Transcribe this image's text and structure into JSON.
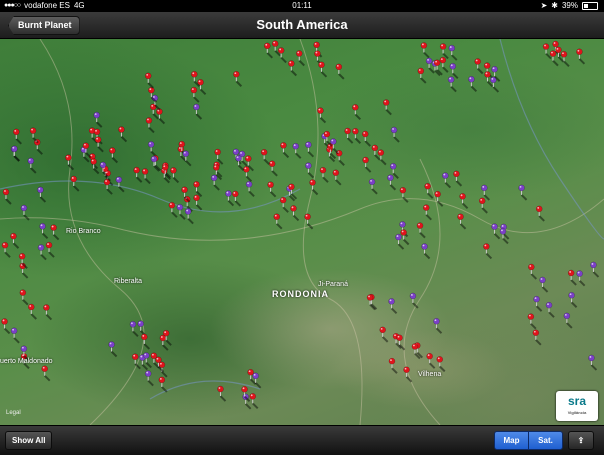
{
  "status_bar": {
    "carrier": "vodafone ES",
    "network": "4G",
    "time": "01:11",
    "battery": "39%"
  },
  "nav": {
    "back_label": "Burnt Planet",
    "title": "South America"
  },
  "map": {
    "labels": {
      "rondonia": "RONDONIA",
      "ji_parana": "Ji-Paraná",
      "rio_branco": "Rio Branco",
      "riberalta": "Riberalta",
      "puerto_maldonado": "uerto Maldonado",
      "vilhena": "Vilhena",
      "legal": "Legal"
    },
    "logo_text": "sra",
    "logo_subtext": "Vigilância"
  },
  "toolbar": {
    "show_all": "Show All",
    "map_label": "Map",
    "sat_label": "Sat."
  },
  "colors": {
    "red_pin": "#e0141c",
    "purple_pin": "#7b3fc8"
  }
}
